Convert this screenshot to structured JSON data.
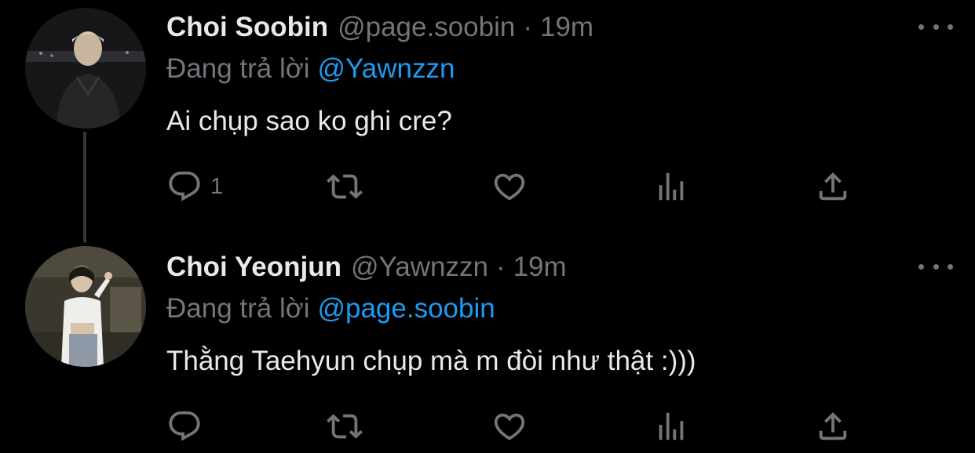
{
  "tweets": [
    {
      "name": "Choi Soobin",
      "handle": "@page.soobin",
      "separator": "·",
      "time": "19m",
      "replying_prefix": "Đang trả lời",
      "replying_to": "@Yawnzzn",
      "text": "Ai chụp sao ko ghi cre?",
      "reply_count": "1"
    },
    {
      "name": "Choi Yeonjun",
      "handle": "@Yawnzzn",
      "separator": "·",
      "time": "19m",
      "replying_prefix": "Đang trả lời",
      "replying_to": "@page.soobin",
      "text": "Thằng Taehyun chụp mà m đòi như thật :)))",
      "reply_count": ""
    }
  ],
  "icons": {
    "reply": "reply-icon",
    "retweet": "retweet-icon",
    "like": "heart-icon",
    "views": "views-icon",
    "share": "share-icon",
    "more": "more-icon"
  },
  "colors": {
    "background": "#000000",
    "text": "#e7e9ea",
    "secondary": "#71767b",
    "mention": "#1d9bf0",
    "thread_line": "#333639"
  }
}
